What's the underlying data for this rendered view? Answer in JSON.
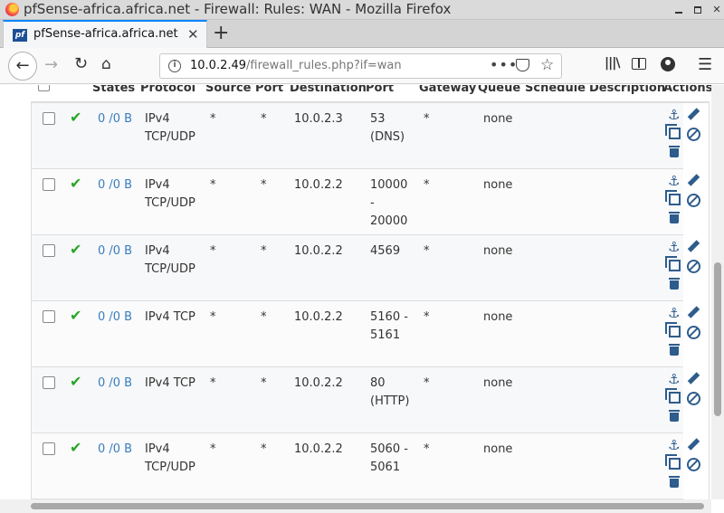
{
  "window": {
    "title": "pfSense-africa.africa.net - Firewall: Rules: WAN - Mozilla Firefox"
  },
  "tab": {
    "title": "pfSense-africa.africa.net",
    "favicon_text": "pf"
  },
  "navbar": {
    "url_host": "10.0.2.49",
    "url_path": "/firewall_rules.php?if=wan",
    "page_actions": "•••"
  },
  "table": {
    "headers": {
      "states": "States",
      "protocol": "Protocol",
      "source": "Source",
      "port": "Port",
      "destination": "Destination",
      "dest_port": "Port",
      "gateway": "Gateway",
      "queue": "Queue",
      "schedule": "Schedule",
      "description": "Description",
      "actions": "Actions"
    },
    "rows": [
      {
        "states": "0 /0 B",
        "protocol": "IPv4\nTCP/UDP",
        "source": "*",
        "port": "*",
        "destination": "10.0.2.3",
        "dest_port": "53\n(DNS)",
        "gateway": "*",
        "queue": "none",
        "schedule": "",
        "description": ""
      },
      {
        "states": "0 /0 B",
        "protocol": "IPv4\nTCP/UDP",
        "source": "*",
        "port": "*",
        "destination": "10.0.2.2",
        "dest_port": "10000\n-\n20000",
        "gateway": "*",
        "queue": "none",
        "schedule": "",
        "description": ""
      },
      {
        "states": "0 /0 B",
        "protocol": "IPv4\nTCP/UDP",
        "source": "*",
        "port": "*",
        "destination": "10.0.2.2",
        "dest_port": "4569",
        "gateway": "*",
        "queue": "none",
        "schedule": "",
        "description": ""
      },
      {
        "states": "0 /0 B",
        "protocol": "IPv4 TCP",
        "source": "*",
        "port": "*",
        "destination": "10.0.2.2",
        "dest_port": "5160 -\n5161",
        "gateway": "*",
        "queue": "none",
        "schedule": "",
        "description": ""
      },
      {
        "states": "0 /0 B",
        "protocol": "IPv4 TCP",
        "source": "*",
        "port": "*",
        "destination": "10.0.2.2",
        "dest_port": "80\n(HTTP)",
        "gateway": "*",
        "queue": "none",
        "schedule": "",
        "description": ""
      },
      {
        "states": "0 /0 B",
        "protocol": "IPv4\nTCP/UDP",
        "source": "*",
        "port": "*",
        "destination": "10.0.2.2",
        "dest_port": "5060 -\n5061",
        "gateway": "*",
        "queue": "none",
        "schedule": "",
        "description": ""
      }
    ]
  },
  "colors": {
    "status_pass": "#2aa52a",
    "states_link": "#3a7dbf",
    "action_icons": "#2e5c8c",
    "tab_accent": "#0a84ff"
  }
}
